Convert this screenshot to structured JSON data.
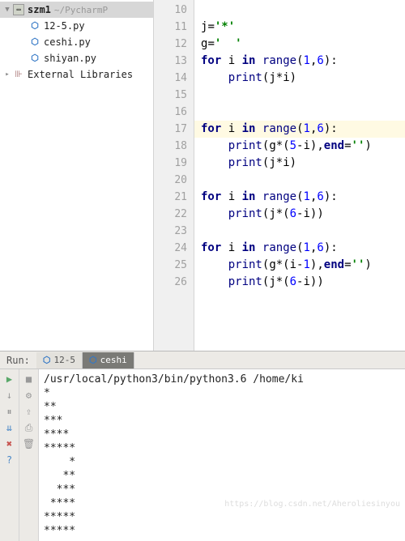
{
  "sidebar": {
    "root": "szm1",
    "root_path": "~/PycharmP",
    "files": [
      {
        "name": "12-5.py",
        "icon": "py"
      },
      {
        "name": "ceshi.py",
        "icon": "py"
      },
      {
        "name": "shiyan.py",
        "icon": "py"
      }
    ],
    "external": "External Libraries"
  },
  "editor": {
    "first_line_no": 10,
    "current_line": 17,
    "lines": [
      {
        "n": 10,
        "raw": ""
      },
      {
        "n": 11,
        "raw": "j='*'"
      },
      {
        "n": 12,
        "raw": "g='  '"
      },
      {
        "n": 13,
        "raw": "for i in range(1,6):"
      },
      {
        "n": 14,
        "raw": "    print(j*i)"
      },
      {
        "n": 15,
        "raw": ""
      },
      {
        "n": 16,
        "raw": ""
      },
      {
        "n": 17,
        "raw": "for i in range(1,6):"
      },
      {
        "n": 18,
        "raw": "    print(g*(5-i),end='')"
      },
      {
        "n": 19,
        "raw": "    print(j*i)"
      },
      {
        "n": 20,
        "raw": ""
      },
      {
        "n": 21,
        "raw": "for i in range(1,6):"
      },
      {
        "n": 22,
        "raw": "    print(j*(6-i))"
      },
      {
        "n": 23,
        "raw": ""
      },
      {
        "n": 24,
        "raw": "for i in range(1,6):"
      },
      {
        "n": 25,
        "raw": "    print(g*(i-1),end='')"
      },
      {
        "n": 26,
        "raw": "    print(j*(6-i))"
      }
    ]
  },
  "run": {
    "label": "Run:",
    "tabs": [
      {
        "name": "12-5",
        "active": false
      },
      {
        "name": "ceshi",
        "active": true
      }
    ],
    "output": [
      "/usr/local/python3/bin/python3.6 /home/ki",
      "*",
      "**",
      "***",
      "****",
      "*****",
      "    *",
      "   **",
      "  ***",
      " ****",
      "*****",
      "*****"
    ]
  },
  "icons": {
    "run": "▶",
    "stop": "■",
    "pause": "⏸",
    "layout": "⇊",
    "print": "⎙",
    "trash": "🗑",
    "close": "✖",
    "help": "?",
    "arrow": "↓"
  },
  "watermark": "https://blog.csdn.net/Aheroliesinyou"
}
